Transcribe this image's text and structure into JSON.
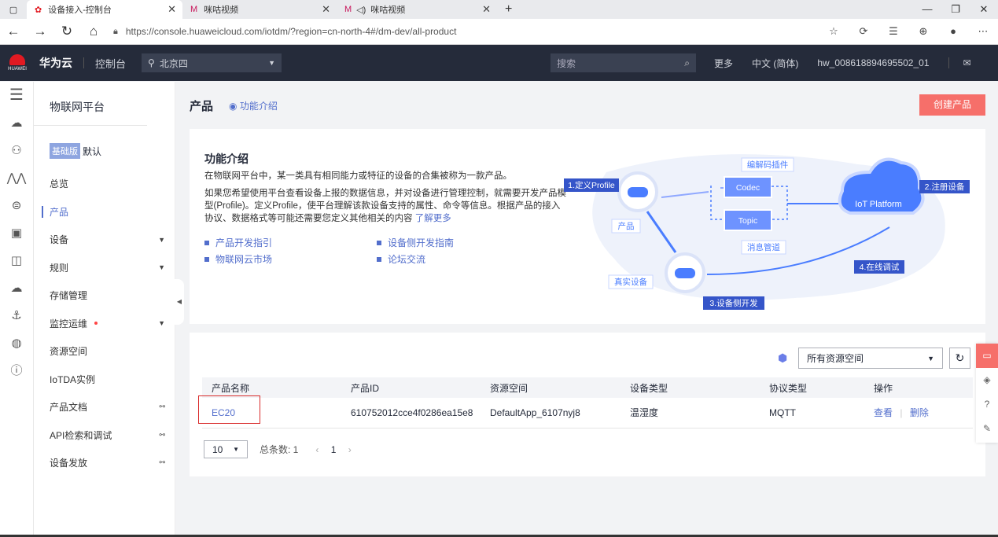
{
  "browser": {
    "tabs": [
      {
        "title": "设备接入-控制台"
      },
      {
        "title": "咪咕视频"
      },
      {
        "title": "咪咕视频"
      }
    ],
    "url": "https://console.huaweicloud.com/iotdm/?region=cn-north-4#/dm-dev/all-product"
  },
  "header": {
    "logo_text": "HUAWEI",
    "brand": "华为云",
    "console": "控制台",
    "region": "北京四",
    "search_placeholder": "搜索",
    "more": "更多",
    "language": "中文 (简体)",
    "account": "hw_008618894695502_01"
  },
  "nav": {
    "title": "物联网平台",
    "edition_badge": "基础版",
    "edition_label": "默认",
    "items": [
      {
        "label": "总览"
      },
      {
        "label": "产品"
      },
      {
        "label": "设备"
      },
      {
        "label": "规则"
      },
      {
        "label": "存储管理"
      },
      {
        "label": "监控运维"
      },
      {
        "label": "资源空间"
      },
      {
        "label": "IoTDA实例"
      },
      {
        "label": "产品文档"
      },
      {
        "label": "API检索和调试"
      },
      {
        "label": "设备发放"
      }
    ]
  },
  "page": {
    "title": "产品",
    "intro_link": "功能介绍",
    "create_button": "创建产品"
  },
  "intro": {
    "heading": "功能介绍",
    "para1": "在物联网平台中，某一类具有相同能力或特征的设备的合集被称为一款产品。",
    "para2": "如果您希望使用平台查看设备上报的数据信息，并对设备进行管理控制，就需要开发产品模型(Profile)。定义Profile，使平台理解该款设备支持的属性、命令等信息。根据产品的接入协议、数据格式等可能还需要您定义其他相关的内容",
    "learn_more": "了解更多",
    "links_left": [
      "产品开发指引",
      "物联网云市场"
    ],
    "links_right": [
      "设备侧开发指南",
      "论坛交流"
    ],
    "diagram": {
      "step1": "1.定义Profile",
      "step2": "2.注册设备",
      "step3": "3.设备侧开发",
      "step4": "4.在线调试",
      "codec_plugin": "编解码插件",
      "codec": "Codec",
      "topic": "Topic",
      "msg_pipe": "消息管道",
      "product": "产品",
      "real_device": "真实设备",
      "platform": "IoT Platform"
    }
  },
  "list": {
    "resource_space": "所有资源空间",
    "columns": [
      "产品名称",
      "产品ID",
      "资源空间",
      "设备类型",
      "协议类型",
      "操作"
    ],
    "rows": [
      {
        "name": "EC20",
        "id": "610752012cce4f0286ea15e8",
        "space": "DefaultApp_6107nyj8",
        "type": "温湿度",
        "protocol": "MQTT",
        "view": "查看",
        "delete": "删除"
      }
    ],
    "page_size": "10",
    "total": "总条数: 1",
    "current_page": "1"
  },
  "colors": {
    "accent": "#526ecc",
    "create": "#f66f6a",
    "header_bg": "#252b3a"
  }
}
